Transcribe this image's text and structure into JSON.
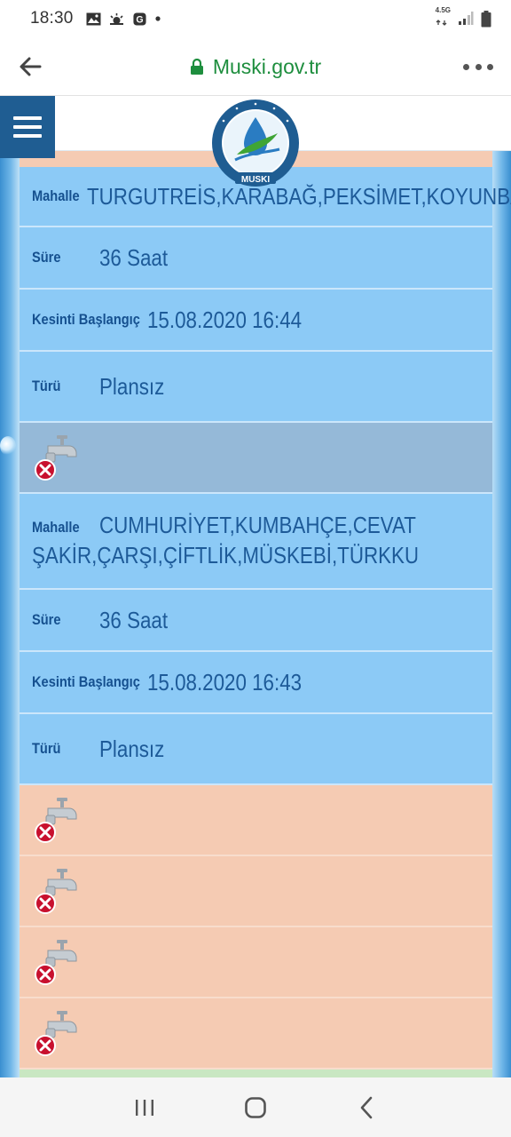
{
  "status_bar": {
    "time": "18:30",
    "network_label": "4.5G",
    "icons": [
      "gallery-icon",
      "weather-icon",
      "google-icon",
      "dot-icon",
      "signal-icon",
      "battery-icon"
    ]
  },
  "browser": {
    "url": "Muski.gov.tr",
    "url_color": "#1e8e3e"
  },
  "site": {
    "logo_text": "MUSKI",
    "brand_color": "#1f5d92"
  },
  "records": [
    {
      "mahalle_label": "Mahalle",
      "mahalle": "TURGUTREİS,KARABAĞ,PEKSİMET,KOYUNBA",
      "sure_label": "Süre",
      "sure": "36 Saat",
      "baslangic_label": "Kesinti Başlangıç",
      "baslangic": "15.08.2020 16:44",
      "turu_label": "Türü",
      "turu": "Plansız"
    },
    {
      "mahalle_label": "Mahalle",
      "mahalle": "CUMHURİYET,KUMBAHÇE,CEVAT",
      "mahalle_line2": "ŞAKİR,ÇARŞI,ÇİFTLİK,MÜSKEBİ,TÜRKKUYUSU,YAKAK",
      "sure_label": "Süre",
      "sure": "36 Saat",
      "baslangic_label": "Kesinti Başlangıç",
      "baslangic": "15.08.2020 16:43",
      "turu_label": "Türü",
      "turu": "Plansız"
    }
  ],
  "colors": {
    "row_blue": "#8ccaf6",
    "row_gray": "#95b9d8",
    "row_peach": "#f5cbb3",
    "text_blue": "#15508f"
  }
}
